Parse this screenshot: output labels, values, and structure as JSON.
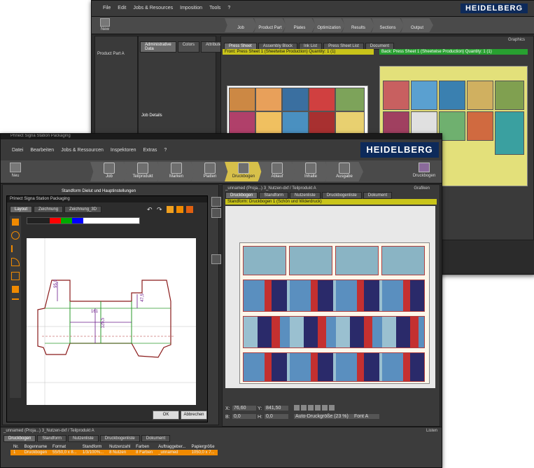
{
  "back_window": {
    "menu": [
      "File",
      "Edit",
      "Jobs & Resources",
      "Imposition",
      "Tools",
      "?"
    ],
    "logo": "HEIDELBERG",
    "workflow": [
      {
        "label": "Job"
      },
      {
        "label": "Product Part"
      },
      {
        "label": "Plates"
      },
      {
        "label": "Optimization"
      },
      {
        "label": "Results"
      },
      {
        "label": "Sections"
      },
      {
        "label": "Output"
      }
    ],
    "new_label": "New",
    "admin_tabs": [
      "Administrative Data",
      "Colors",
      "Attributes"
    ],
    "job_details_label": "Job Details",
    "sheet_tabs": [
      "Press Sheet",
      "Assembly Block",
      "Ink List",
      "Press Sheet List",
      "Document"
    ],
    "sheet_bar_left": "Front: Press Sheet 1 (Sheetwise Production)  Quantity: 1 (1)",
    "sheet_bar_right": "Back: Press Sheet 1 (Sheetwise Production)  Quantity: 1 (1)",
    "product_part": "Product Part A",
    "graphics_label": "Graphics"
  },
  "front_window": {
    "title": "Prinect Signa Station Packaging",
    "menu": [
      "Datei",
      "Bearbeiten",
      "Jobs & Ressourcen",
      "Inspektoren",
      "Extras",
      "?"
    ],
    "logo": "HEIDELBERG",
    "new_label": "Neu",
    "workflow": [
      {
        "label": "Job",
        "active": false
      },
      {
        "label": "Teilprodukt",
        "active": false
      },
      {
        "label": "Marken",
        "active": false
      },
      {
        "label": "Platten",
        "active": false
      },
      {
        "label": "Druckbogen",
        "active": true
      },
      {
        "label": "Ablauf",
        "active": false
      },
      {
        "label": "Inhalte",
        "active": false
      },
      {
        "label": "Ausgabe",
        "active": false
      }
    ],
    "right_tool_label": "Druckbogen",
    "left_panel_title": "Standform Dielut und Hauptinstellungen",
    "dialog": {
      "title": "Prinect Signa Station Packaging",
      "tabs": [
        "Layout",
        "Zeichnung",
        "Zeichnung_3D"
      ],
      "dims": {
        "top": "95,0",
        "middle": "161",
        "side": "125,5",
        "right": "47,5"
      },
      "ok_label": "OK",
      "cancel_label": "Abbrechen"
    },
    "sheet_tabs": [
      "Druckbogen",
      "Standform",
      "Nutzenliste",
      "Druckbogenliste",
      "Dokument"
    ],
    "sheet_bar": "Standform: Druckbogen 1 (Schön und Widerdruck)",
    "sheet_title": "_unnamed (Proja...) 3_Nutzen-dxf / Teilprodukt A",
    "graphics_label": "Grafiken",
    "coords": {
      "x_label": "X:",
      "x_val": "76,60",
      "y_label": "Y:",
      "y_val": "841,50",
      "b_label": "B:",
      "b_val": "0,0",
      "h_label": "H:",
      "h_val": "0,0"
    },
    "zoom_select": "Auto-Druckgröße (23 %)",
    "font_select": "Font A",
    "bottom_tabs": [
      "Druckbogen",
      "Standform",
      "Nutzenliste",
      "Druckbogenliste",
      "Dokument"
    ],
    "list_headers": [
      "Nr.",
      "Bogenname",
      "Format",
      "Standform",
      "Nutzenzahl",
      "Farben",
      "Auftraggeber...",
      "Papiergröße"
    ],
    "list_row": [
      "1",
      "Druckbogen",
      "55/50,0 x 8...",
      "1/3/100%...",
      "8 Nutzen",
      "8 Farben",
      "_unnamed",
      "1050,0 x 7..."
    ],
    "list_panel_title": "_unnamed (Proja...) 3_Nutzen-dxf / Teilprodukt A",
    "list_label": "Listen"
  }
}
